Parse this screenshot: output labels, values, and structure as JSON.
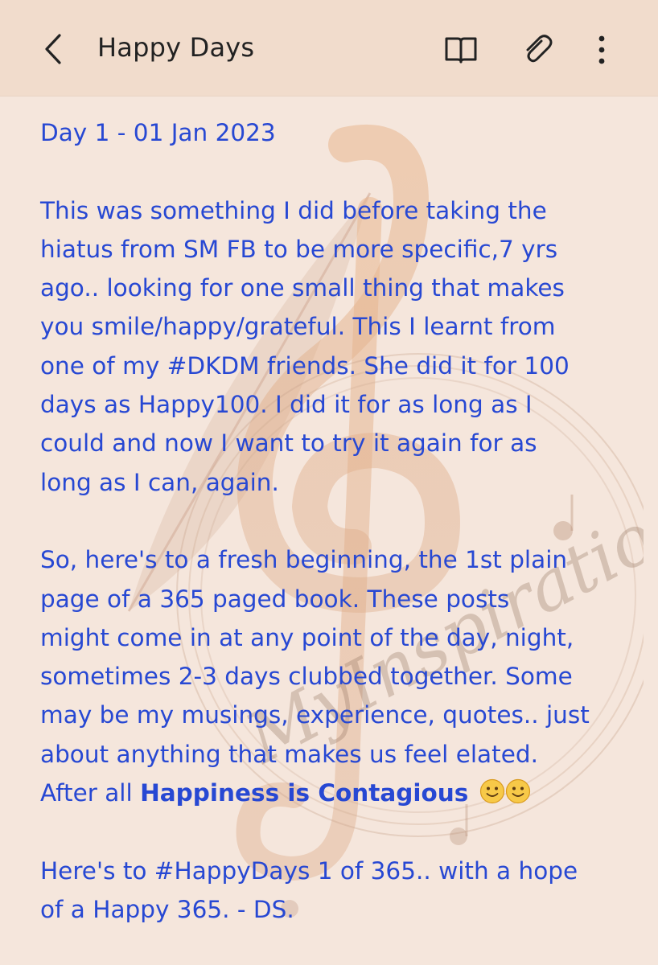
{
  "header": {
    "title": "Happy Days",
    "icons": {
      "back": "chevron-left-icon",
      "reader": "book-icon",
      "attach": "paperclip-icon",
      "more": "more-vertical-icon"
    }
  },
  "watermark": {
    "text": "MyInspirations"
  },
  "note": {
    "date_line": "Day 1 - 01 Jan 2023",
    "paragraph1": [
      "This was something I did before taking the",
      "hiatus from SM  FB to be more specific,7 yrs",
      "ago.. looking for one small thing that makes",
      "you smile/happy/grateful. This I learnt from",
      "one of my #DKDM friends. She did it for 100",
      "days as Happy100. I did it for as long as I",
      "could and now I want to try it again  for as",
      "long as I can, again."
    ],
    "paragraph2": [
      "So, here's to a fresh beginning, the 1st plain",
      "page of a 365 paged book. These posts",
      "might come in at any point of the day, night,",
      "sometimes 2-3 days clubbed together. Some",
      "may be my musings, experience, quotes.. just",
      "about anything that makes us feel elated."
    ],
    "last_line_prefix": "After all ",
    "last_line_bold": "Happiness is Contagious",
    "emoji": "slightly-smiling-face-icon",
    "paragraph3": [
      "Here's to #HappyDays 1 of 365.. with a hope",
      "of a Happy 365. - DS."
    ]
  },
  "colors": {
    "background": "#f5e6dc",
    "header_bg": "#f1dccc",
    "text": "#2748d3"
  }
}
